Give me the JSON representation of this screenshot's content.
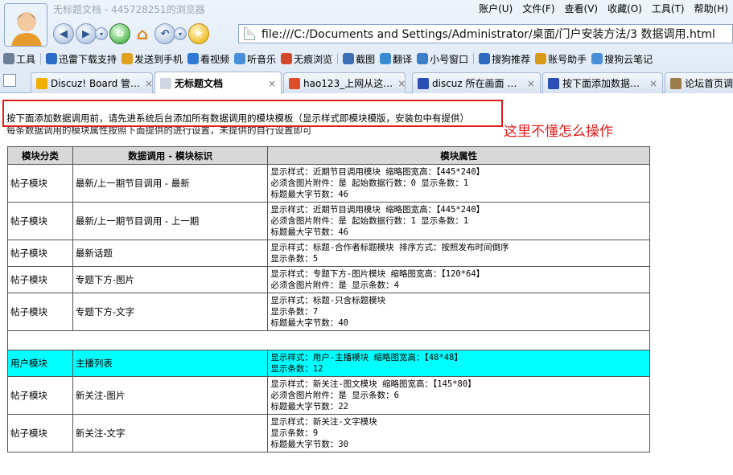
{
  "window": {
    "title": "无标题文档 - 445728251的浏览器"
  },
  "menubar": [
    "账户(U)",
    "文件(F)",
    "查看(V)",
    "收藏(O)",
    "工具(T)",
    "帮助(H)"
  ],
  "address": {
    "url": "file:///C:/Documents and Settings/Administrator/桌面/门户安装方法/3 数据调用.html"
  },
  "toolbar": {
    "items": [
      {
        "label": "工具",
        "icon": "gear-icon",
        "color": "#6d7f96"
      },
      {
        "label": "迅雷下载支持",
        "icon": "thunder-icon",
        "color": "#2b6cc4"
      },
      {
        "label": "发送到手机",
        "icon": "phone-icon",
        "color": "#e0a020"
      },
      {
        "label": "看视频",
        "icon": "video-icon",
        "color": "#2f7ad6"
      },
      {
        "label": "听音乐",
        "icon": "music-icon",
        "color": "#4a90d9"
      },
      {
        "label": "无痕浏览",
        "icon": "incognito-icon",
        "color": "#d24a2b"
      },
      {
        "label": "截图",
        "icon": "scissors-icon",
        "color": "#3b6fb5"
      },
      {
        "label": "翻译",
        "icon": "translate-icon",
        "color": "#3a8ad0"
      },
      {
        "label": "小号窗口",
        "icon": "person-icon",
        "color": "#3a7fc8"
      },
      {
        "label": "搜狗推荐",
        "icon": "search-icon",
        "color": "#2e6bc0"
      },
      {
        "label": "账号助手",
        "icon": "key-icon",
        "color": "#d99a1a"
      },
      {
        "label": "搜狗云笔记",
        "icon": "note-icon",
        "color": "#4a8ed8"
      }
    ]
  },
  "tabs": [
    {
      "label": "Discuz! Board 管…",
      "icon": "discuz-icon",
      "color": "#f1b000"
    },
    {
      "label": "无标题文档",
      "icon": "document-icon",
      "color": "#cfd7e2"
    },
    {
      "label": "hao123_上网从这…",
      "icon": "hao123-icon",
      "color": "#e04d2d"
    },
    {
      "label": "discuz 所在画面 …",
      "icon": "paw-icon",
      "color": "#2b4fb5"
    },
    {
      "label": "按下面添加数据…",
      "icon": "paw-icon",
      "color": "#2b4fb5"
    },
    {
      "label": "论坛首页调…",
      "icon": "page-icon",
      "color": "#9b7d4a"
    }
  ],
  "page": {
    "note1": "按下面添加数据调用前，请先进系统后台添加所有数据调用的模块模板（显示样式即模块模版，安装包中有提供）",
    "note2": "每条数据调用的模块属性按照下面提供的进行设置，未提供的自行设置即可",
    "annotation": "这里不懂怎么操作",
    "annotation_color": "#e21b1b",
    "highlight_color": "#00ffff"
  },
  "table": {
    "headers": [
      "模块分类",
      "数据调用 - 模块标识",
      "模块属性"
    ],
    "rows": [
      {
        "category": "帖子模块",
        "name": "最新/上一期节目调用 - 最新",
        "props": [
          "显示样式：近期节目调用模块 缩略图宽高：【445*240】",
          "必须含图片附件：是 起始数据行数：0 显示条数：1",
          "标题最大字节数：46"
        ]
      },
      {
        "category": "帖子模块",
        "name": "最新/上一期节目调用 - 上一期",
        "props": [
          "显示样式：近期节目调用模块 缩略图宽高：【445*240】",
          "必须含图片附件：是 起始数据行数：1 显示条数：1",
          "标题最大字节数：46"
        ]
      },
      {
        "category": "帖子模块",
        "name": "最新话题",
        "props": [
          "显示样式：标题-合作者标题模块 排序方式：按照发布时间倒序",
          "显示条数：5"
        ]
      },
      {
        "category": "帖子模块",
        "name": "专题下方-图片",
        "props": [
          "显示样式：专题下方-图片模块 缩略图宽高：【120*64】",
          "必须含图片附件：是 显示条数：4"
        ]
      },
      {
        "category": "帖子模块",
        "name": "专题下方-文字",
        "props": [
          "显示样式：标题-只含标题模块",
          "显示条数：7",
          "标题最大字节数：40"
        ]
      },
      {
        "blank": true
      },
      {
        "category": "用户模块",
        "name": "主播列表",
        "highlight": true,
        "props": [
          "显示样式：用户-主播模块 缩略图宽高：【48*48】",
          "显示条数：12"
        ]
      },
      {
        "category": "帖子模块",
        "name": "新关注-图片",
        "props": [
          "显示样式：新关注-图文模块 缩略图宽高：【145*80】",
          "必须含图片附件：是 显示条数：6",
          "标题最大字节数：22"
        ]
      },
      {
        "category": "帖子模块",
        "name": "新关注-文字",
        "props": [
          "显示样式：新关注-文字模块",
          "显示条数：9",
          "标题最大字节数：30"
        ]
      }
    ]
  }
}
